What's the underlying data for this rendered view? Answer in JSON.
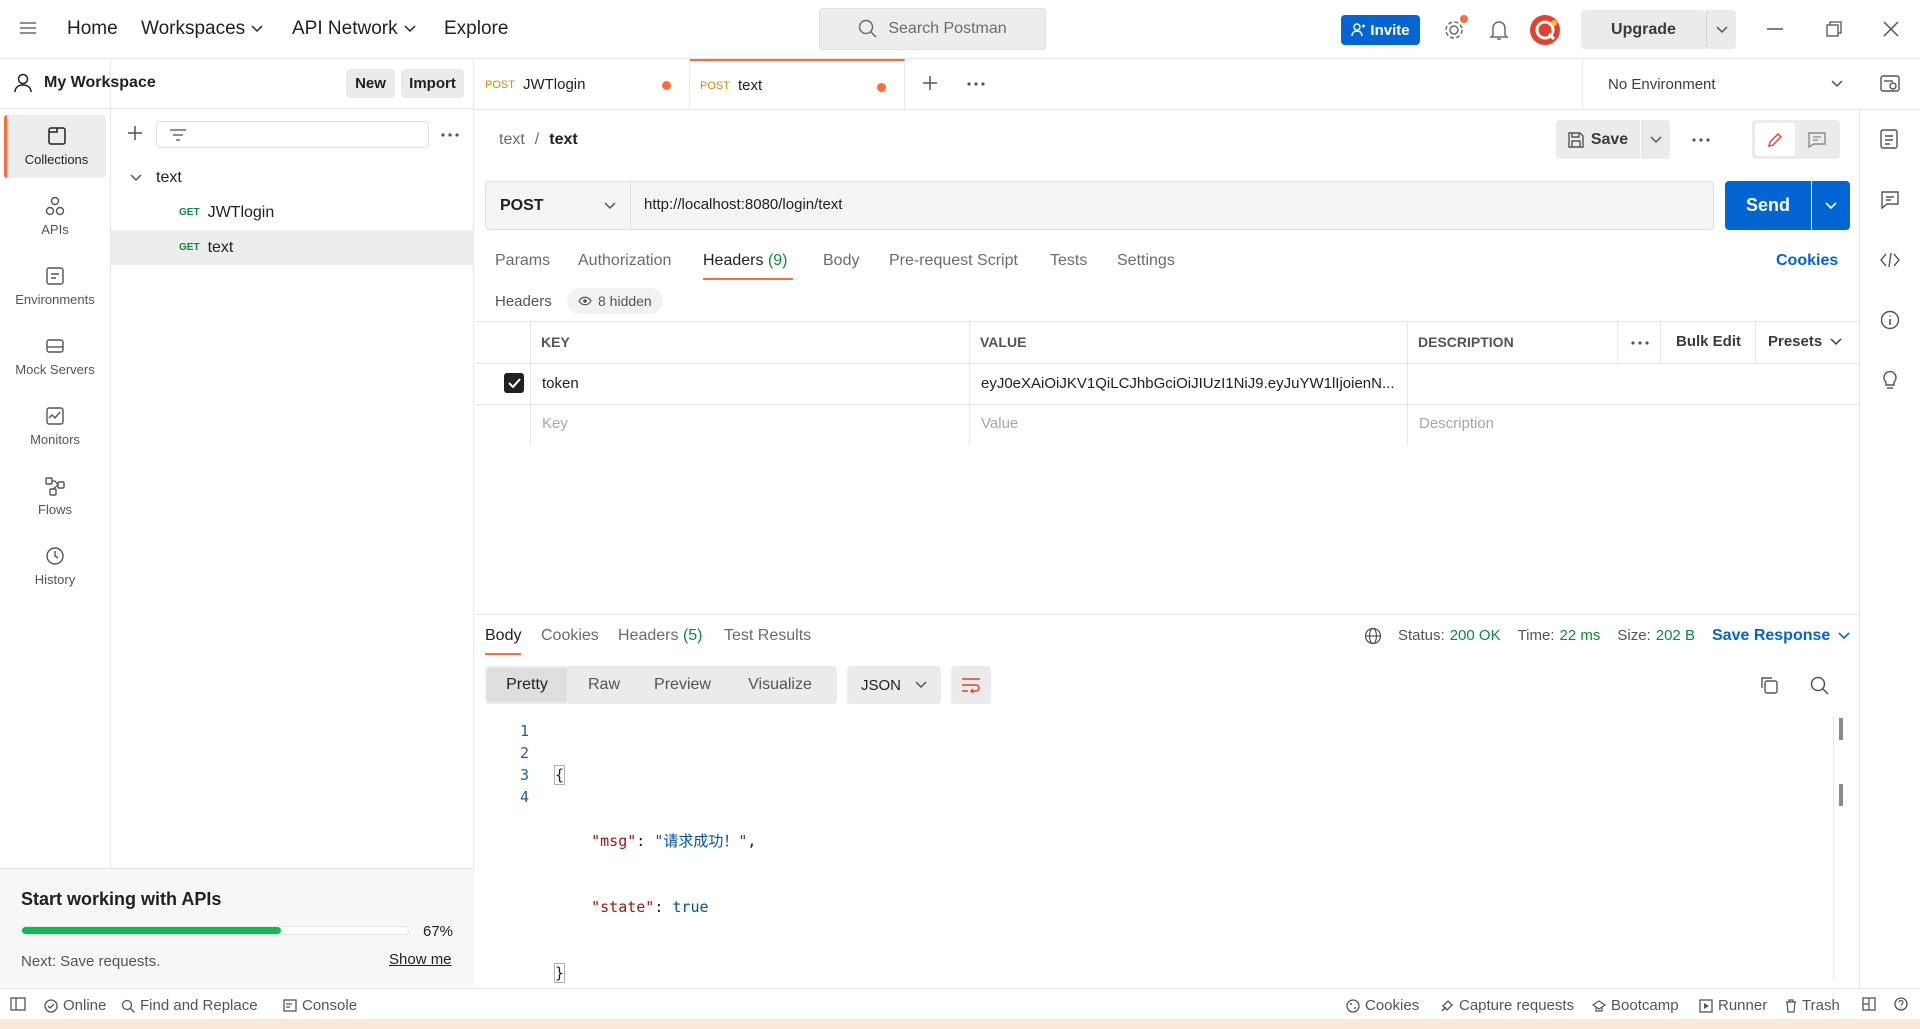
{
  "topbar": {
    "nav": [
      "Home",
      "Workspaces",
      "API Network",
      "Explore"
    ],
    "search_placeholder": "Search Postman",
    "invite": "Invite",
    "upgrade": "Upgrade"
  },
  "rail": {
    "items": [
      "Collections",
      "APIs",
      "Environments",
      "Mock Servers",
      "Monitors",
      "Flows",
      "History"
    ]
  },
  "sidebar": {
    "workspace": "My Workspace",
    "new_label": "New",
    "import_label": "Import",
    "collection": "text",
    "requests": [
      {
        "method": "GET",
        "name": "JWTlogin"
      },
      {
        "method": "GET",
        "name": "text"
      }
    ]
  },
  "promo": {
    "title": "Start working with APIs",
    "progress": 0.67,
    "progress_label": "67%",
    "next": "Next: Save requests.",
    "show_me": "Show me"
  },
  "tabs": [
    {
      "method": "POST",
      "name": "JWTlogin"
    },
    {
      "method": "POST",
      "name": "text"
    }
  ],
  "environment": "No Environment",
  "breadcrumb": {
    "parent": "text",
    "sep": "/",
    "current": "text"
  },
  "save_label": "Save",
  "request": {
    "method": "POST",
    "url": "http://localhost:8080/login/text",
    "send": "Send",
    "tabs": [
      "Params",
      "Authorization",
      "Headers",
      "(9)",
      "Body",
      "Pre-request Script",
      "Tests",
      "Settings"
    ],
    "cookies": "Cookies"
  },
  "headers_section": {
    "title": "Headers",
    "hidden": "8 hidden",
    "columns": [
      "KEY",
      "VALUE",
      "DESCRIPTION"
    ],
    "bulk_edit": "Bulk Edit",
    "presets": "Presets",
    "row": {
      "key": "token",
      "value": "eyJ0eXAiOiJKV1QiLCJhbGciOiJIUzI1NiJ9.eyJuYW1lIjoienN..."
    },
    "placeholders": {
      "key": "Key",
      "value": "Value",
      "description": "Description"
    }
  },
  "response": {
    "tabs": [
      "Body",
      "Cookies",
      "Headers",
      "(5)",
      "Test Results"
    ],
    "status_label": "Status:",
    "status_value": "200 OK",
    "time_label": "Time:",
    "time_value": "22 ms",
    "size_label": "Size:",
    "size_value": "202 B",
    "save_response": "Save Response",
    "view_modes": [
      "Pretty",
      "Raw",
      "Preview",
      "Visualize"
    ],
    "format": "JSON",
    "line_numbers": [
      "1",
      "2",
      "3",
      "4"
    ],
    "code": {
      "open": "{",
      "k1": "\"msg\"",
      "v1": "\"请求成功！\"",
      "k2": "\"state\"",
      "v2": "true",
      "close": "}"
    }
  },
  "statusbar": {
    "left": [
      "Online",
      "Find and Replace",
      "Console"
    ],
    "right": [
      "Cookies",
      "Capture requests",
      "Bootcamp",
      "Runner",
      "Trash"
    ]
  }
}
